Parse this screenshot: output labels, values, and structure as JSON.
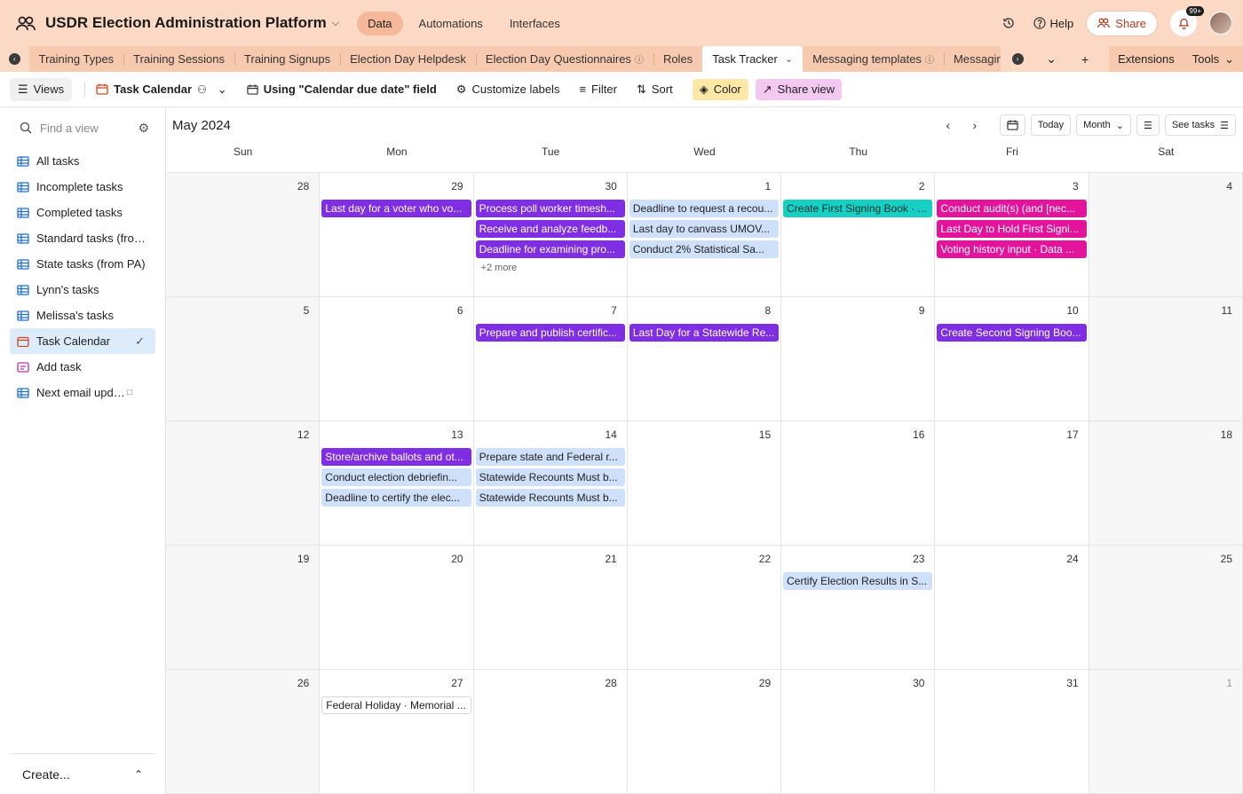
{
  "app": {
    "base_title": "USDR Election Administration Platform",
    "nav": [
      {
        "label": "Data",
        "active": true
      },
      {
        "label": "Automations",
        "active": false
      },
      {
        "label": "Interfaces",
        "active": false
      }
    ],
    "help_label": "Help",
    "share_label": "Share",
    "notifications_badge": "99+"
  },
  "tabs": [
    {
      "label": "Training Types"
    },
    {
      "label": "Training Sessions"
    },
    {
      "label": "Training Signups"
    },
    {
      "label": "Election Day Helpdesk"
    },
    {
      "label": "Election Day Questionnaires"
    },
    {
      "label": "Roles"
    },
    {
      "label": "Task Tracker"
    },
    {
      "label": "Messaging templates"
    },
    {
      "label": "Messaging log"
    }
  ],
  "tabs_right": {
    "extensions": "Extensions",
    "tools": "Tools"
  },
  "viewbar": {
    "views": "Views",
    "current_view": "Task Calendar",
    "date_field": "Using \"Calendar due date\" field",
    "customize": "Customize labels",
    "filter": "Filter",
    "sort": "Sort",
    "color": "Color",
    "share_view": "Share view"
  },
  "sidebar": {
    "search_placeholder": "Find a view",
    "items": [
      {
        "label": "All tasks",
        "icon": "grid"
      },
      {
        "label": "Incomplete tasks",
        "icon": "grid"
      },
      {
        "label": "Completed tasks",
        "icon": "grid"
      },
      {
        "label": "Standard tasks (from...",
        "icon": "grid"
      },
      {
        "label": "State tasks (from PA)",
        "icon": "grid"
      },
      {
        "label": "Lynn's tasks",
        "icon": "grid"
      },
      {
        "label": "Melissa's tasks",
        "icon": "grid"
      },
      {
        "label": "Task Calendar",
        "icon": "calendar",
        "active": true
      },
      {
        "label": "Add task",
        "icon": "form"
      },
      {
        "label": "Next email update",
        "icon": "grid",
        "locked": true
      }
    ],
    "create_label": "Create..."
  },
  "calendar": {
    "month_label": "May 2024",
    "today_label": "Today",
    "range_label": "Month",
    "see_tasks_label": "See tasks",
    "weekdays": [
      "Sun",
      "Mon",
      "Tue",
      "Wed",
      "Thu",
      "Fri",
      "Sat"
    ],
    "colors": {
      "purple": "#7f2ee3",
      "blue": "#cfe0fb",
      "teal": "#17d0c4",
      "pink": "#e3139c"
    },
    "weeks": [
      [
        {
          "day": "28",
          "muted": false,
          "events": []
        },
        {
          "day": "29",
          "events": [
            {
              "text": "Last day for a voter who vo...",
              "color": "purple"
            }
          ]
        },
        {
          "day": "30",
          "events": [
            {
              "text": "Process poll worker timesh...",
              "color": "purple"
            },
            {
              "text": "Receive and analyze feedb...",
              "color": "purple"
            },
            {
              "text": "Deadline for examining pro...",
              "color": "purple"
            }
          ],
          "more": "+2 more"
        },
        {
          "day": "1",
          "events": [
            {
              "text": "Deadline to request a recou...",
              "color": "blue"
            },
            {
              "text": "Last day to canvass UMOV...",
              "color": "blue"
            },
            {
              "text": "Conduct 2% Statistical Sa...",
              "color": "blue"
            }
          ]
        },
        {
          "day": "2",
          "events": [
            {
              "text": "Create First Signing Book · ...",
              "color": "teal"
            }
          ]
        },
        {
          "day": "3",
          "events": [
            {
              "text": "Conduct audit(s) (and [nec...",
              "color": "pink"
            },
            {
              "text": "Last Day to Hold First Signi...",
              "color": "pink"
            },
            {
              "text": "Voting history input · Data ...",
              "color": "pink"
            }
          ]
        },
        {
          "day": "4",
          "events": []
        }
      ],
      [
        {
          "day": "5",
          "events": []
        },
        {
          "day": "6",
          "events": []
        },
        {
          "day": "7",
          "events": [
            {
              "text": "Prepare and publish certific...",
              "color": "purple"
            }
          ]
        },
        {
          "day": "8",
          "events": [
            {
              "text": "Last Day for a Statewide Re...",
              "color": "purple"
            }
          ]
        },
        {
          "day": "9",
          "events": []
        },
        {
          "day": "10",
          "events": [
            {
              "text": "Create Second Signing Boo...",
              "color": "purple"
            }
          ]
        },
        {
          "day": "11",
          "events": []
        }
      ],
      [
        {
          "day": "12",
          "events": []
        },
        {
          "day": "13",
          "events": [
            {
              "text": "Store/archive ballots and ot...",
              "color": "purple"
            },
            {
              "text": "Conduct election debriefin...",
              "color": "blue"
            },
            {
              "text": "Deadline to certify the elec...",
              "color": "blue"
            }
          ]
        },
        {
          "day": "14",
          "events": [
            {
              "text": "Prepare state and Federal r...",
              "color": "blue"
            },
            {
              "text": "Statewide Recounts Must b...",
              "color": "blue"
            },
            {
              "text": "Statewide Recounts Must b...",
              "color": "blue"
            }
          ]
        },
        {
          "day": "15",
          "events": []
        },
        {
          "day": "16",
          "events": []
        },
        {
          "day": "17",
          "events": []
        },
        {
          "day": "18",
          "events": []
        }
      ],
      [
        {
          "day": "19",
          "events": []
        },
        {
          "day": "20",
          "events": []
        },
        {
          "day": "21",
          "events": []
        },
        {
          "day": "22",
          "events": []
        },
        {
          "day": "23",
          "events": [
            {
              "text": "Certify Election Results in S...",
              "color": "blue"
            }
          ]
        },
        {
          "day": "24",
          "events": []
        },
        {
          "day": "25",
          "events": []
        }
      ],
      [
        {
          "day": "26",
          "events": []
        },
        {
          "day": "27",
          "events": [
            {
              "text": "Federal Holiday · Memorial ...",
              "color": "white"
            }
          ]
        },
        {
          "day": "28",
          "events": []
        },
        {
          "day": "29",
          "events": []
        },
        {
          "day": "30",
          "events": []
        },
        {
          "day": "31",
          "events": []
        },
        {
          "day": "1",
          "muted": true,
          "events": []
        }
      ]
    ]
  }
}
